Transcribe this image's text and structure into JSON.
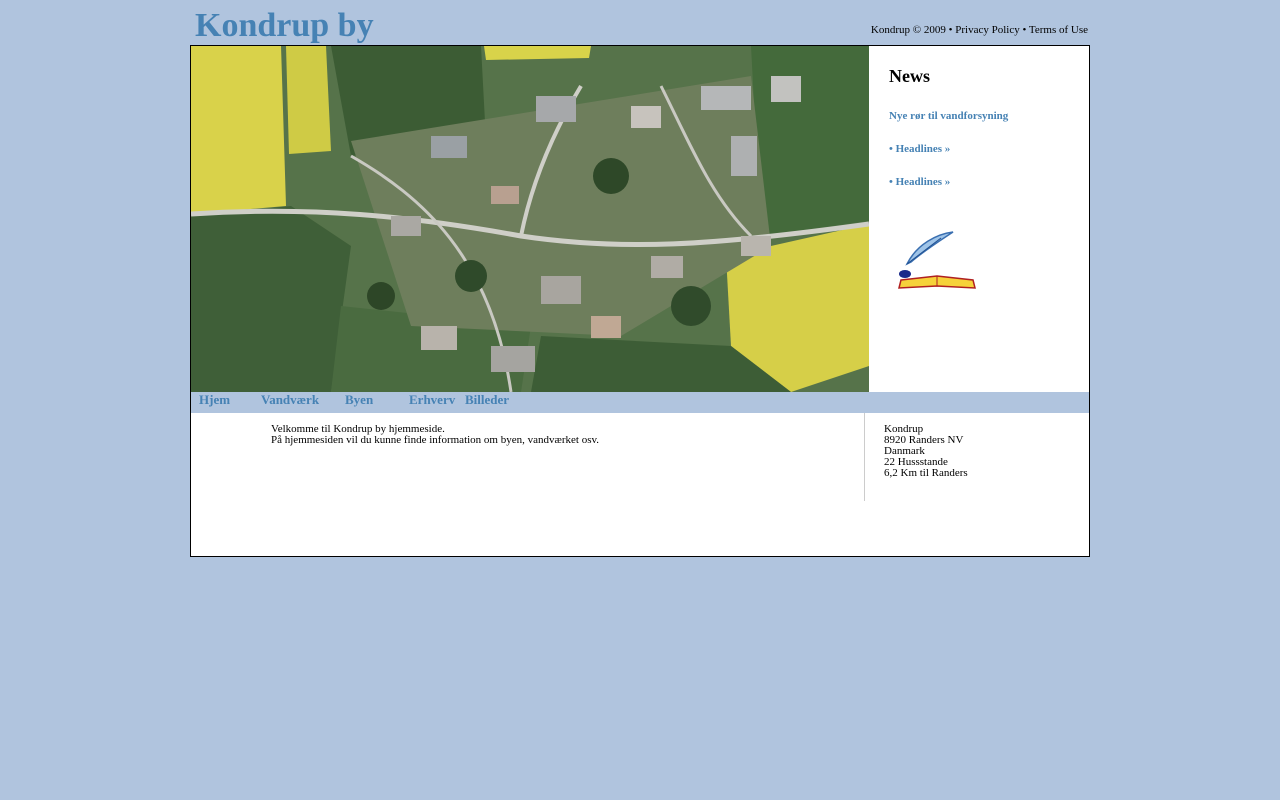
{
  "header": {
    "site_title": "Kondrup by",
    "copyright": "Kondrup © 2009",
    "separator": "•",
    "privacy_link": "Privacy Policy",
    "terms_link": "Terms of Use"
  },
  "news": {
    "title": "News",
    "items": [
      "Nye rør til vandforsyning",
      "• Headlines »",
      "• Headlines »"
    ],
    "image_icon": "quill-and-book-icon"
  },
  "nav": {
    "items": [
      "Hjem",
      "Vandværk",
      "Byen",
      "Erhverv",
      "Billeder"
    ]
  },
  "content": {
    "line1": "Velkomme til Kondrup by hjemmeside.",
    "line2": "På hjemmesiden vil du kunne finde information om byen, vandværket osv."
  },
  "address": {
    "lines": [
      "Kondrup",
      "8920 Randers NV",
      "Danmark",
      "22 Hussstande",
      "6,2 Km til Randers"
    ]
  },
  "colors": {
    "background": "#b0c4de",
    "accent": "#4682b4",
    "panel": "#ffffff"
  }
}
